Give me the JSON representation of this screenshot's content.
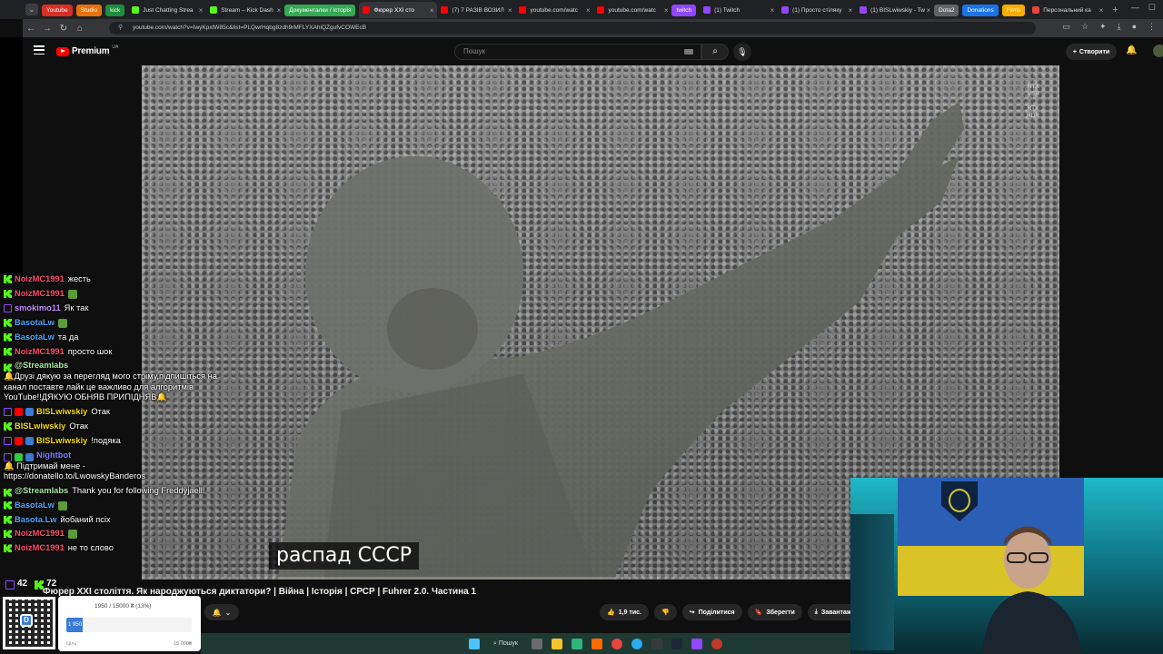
{
  "browser": {
    "tab_groups": [
      {
        "label": "Youtube",
        "color": "#d93025"
      },
      {
        "label": "Studio",
        "color": "#e8710a"
      },
      {
        "label": "kick",
        "color": "#1e8e3e"
      }
    ],
    "tabs": [
      {
        "label": "Just Chatting Strea",
        "favicon_color": "#53fc18",
        "active": false
      },
      {
        "label": "Stream – Kick Dash",
        "favicon_color": "#53fc18",
        "active": false
      }
    ],
    "tab_group_docs": {
      "label": "Документалки / Історія",
      "color": "#34a853"
    },
    "tabs_2": [
      {
        "label": "Фюрер XXI сто",
        "favicon_color": "#ff0000",
        "active": true
      },
      {
        "label": "(7) 7 РАЗІВ ВОЗИЛ",
        "favicon_color": "#ff0000",
        "active": false
      },
      {
        "label": "youtube.com/watc",
        "favicon_color": "#ff0000",
        "active": false
      },
      {
        "label": "youtube.com/watc",
        "favicon_color": "#ff0000",
        "active": false
      }
    ],
    "tab_group_twitch": {
      "label": "twitch",
      "color": "#9146ff"
    },
    "tabs_3": [
      {
        "label": "(1) Twitch",
        "favicon_color": "#9146ff",
        "active": false
      },
      {
        "label": "(1) Просто стіляку",
        "favicon_color": "#9146ff",
        "active": false
      },
      {
        "label": "(1) BISLwiwskiy - Tw",
        "favicon_color": "#9146ff",
        "active": false
      }
    ],
    "tab_group_dota": {
      "label": "Dota2",
      "color": "#5f6368"
    },
    "tab_group_donations": {
      "label": "Donations",
      "color": "#1a73e8"
    },
    "tab_group_films": {
      "label": "Films",
      "color": "#f9ab00"
    },
    "tabs_4": [
      {
        "label": "Персональний ка",
        "favicon_color": "#e8453c",
        "active": false
      }
    ],
    "url": "youtube.com/watch?v=IwyKpxtW85c&list=PLQwrHqbg8zdh9rMFLYXAhiQZgufvCOWEcB"
  },
  "youtube": {
    "logo_text": "Premium",
    "logo_region": "UA",
    "search_placeholder": "Пошук",
    "create_label": "Створити",
    "video": {
      "subtitle": "распад СССР",
      "rtx_vsr": "RTX\nVSR",
      "rtx_hdr": "RTX\nHDR"
    },
    "title": "Фюрер XXI століття. Як народжуються диктатори? | Війна | Історія | СРСР | Fuhrer 2.0. Частина 1",
    "like_count": "1,9 тис.",
    "share_label": "Поділитися",
    "save_label": "Зберегти",
    "download_label": "Завантажити"
  },
  "chat": {
    "messages": [
      {
        "badges": [
          "kick"
        ],
        "user": "NoizMC1991",
        "user_color": "#ff4d6d",
        "text": "жесть",
        "emote": false
      },
      {
        "badges": [
          "kick"
        ],
        "user": "NoizMC1991",
        "user_color": "#ff4d6d",
        "text": "",
        "emote": true
      },
      {
        "badges": [
          "twitch"
        ],
        "user": "smokimo11",
        "user_color": "#c98cff",
        "text": "Як так",
        "emote": false
      },
      {
        "badges": [
          "kick"
        ],
        "user": "BasotaLw",
        "user_color": "#4da6ff",
        "text": "",
        "emote": true
      },
      {
        "badges": [
          "kick"
        ],
        "user": "BasotaLw",
        "user_color": "#4da6ff",
        "text": "та да",
        "emote": false
      },
      {
        "badges": [
          "kick"
        ],
        "user": "NoizMC1991",
        "user_color": "#ff4d6d",
        "text": "просто шок",
        "emote": false
      },
      {
        "badges": [
          "kick"
        ],
        "user": "@Streamlabs",
        "user_color": "#a8e6a1",
        "text": "🔔Друзі дякую за перегляд мого стріму,підпишіться на канал поставте лайк це важливо для алгоритмів YouTube!!ДЯКУЮ ОБНЯВ ПРИПІДНЯВ🔔",
        "emote": false,
        "wrap": true
      },
      {
        "badges": [
          "twitch",
          "yt",
          "sub"
        ],
        "user": "BISLwiwskiy",
        "user_color": "#f5d90a",
        "text": "Отак",
        "emote": false
      },
      {
        "badges": [
          "kick"
        ],
        "user": "BISLwiwskiy",
        "user_color": "#f5d90a",
        "text": "Отак",
        "emote": false
      },
      {
        "badges": [
          "twitch",
          "yt",
          "sub"
        ],
        "user": "BISLwiwskiy",
        "user_color": "#f5d90a",
        "text": "!подяка",
        "emote": false
      },
      {
        "badges": [
          "twitch",
          "green",
          "sub"
        ],
        "user": "Nightbot",
        "user_color": "#7b7bff",
        "text": "🔔 Підтримай мене - https://donatello.to/LwowskyBanderos",
        "emote": false,
        "wrap": true
      },
      {
        "badges": [
          "kick"
        ],
        "user": "@Streamlabs",
        "user_color": "#a8e6a1",
        "text": "Thank you for following Freddyjaell!",
        "emote": false,
        "wrap": true
      },
      {
        "badges": [
          "kick"
        ],
        "user": "BasotaLw",
        "user_color": "#4da6ff",
        "text": "",
        "emote": true
      },
      {
        "badges": [
          "kick"
        ],
        "user": "Basota.Lw",
        "user_color": "#4da6ff",
        "text": "йобаний псіх",
        "emote": false
      },
      {
        "badges": [
          "kick"
        ],
        "user": "NoizMC1991",
        "user_color": "#ff4d6d",
        "text": "",
        "emote": true
      },
      {
        "badges": [
          "kick"
        ],
        "user": "NoizMC1991",
        "user_color": "#ff4d6d",
        "text": "не то слово",
        "emote": false
      }
    ]
  },
  "counters": {
    "twitch_viewers": "42",
    "kick_viewers": "72"
  },
  "donation": {
    "progress_text": "1950 / 15000 ₴ (13%)",
    "fill_label": "1 950",
    "progress_fraction": 0.13,
    "left_label": "Ціль:",
    "right_label": "15 000₴"
  },
  "taskbar": {
    "search_label": "Пошук"
  }
}
